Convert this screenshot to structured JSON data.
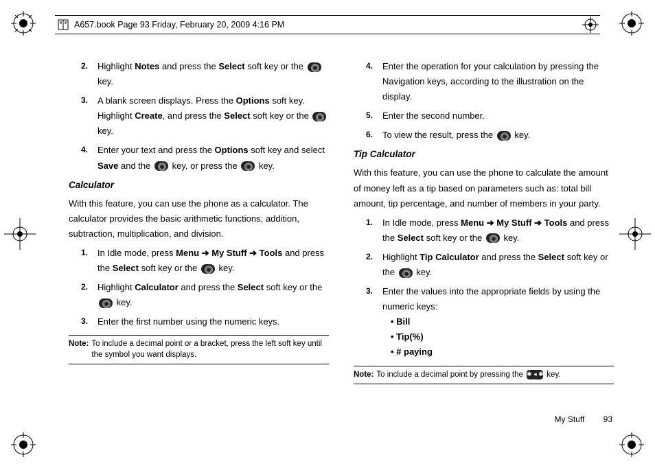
{
  "header": {
    "text": "A657.book  Page 93  Friday, February 20, 2009  4:16 PM"
  },
  "left": {
    "s2a": "Highlight ",
    "s2b": "Notes",
    "s2c": " and press the ",
    "s2d": "Select",
    "s2e": " soft key or the ",
    "s2f": " key.",
    "s3a": "A blank screen displays. Press the ",
    "s3b": "Options",
    "s3c": " soft key. Highlight ",
    "s3d": "Create",
    "s3e": ", and press the ",
    "s3f": "Select",
    "s3g": " soft key or the ",
    "s3h": " key.",
    "s4a": "Enter your text and press the ",
    "s4b": "Options",
    "s4c": " soft key and select ",
    "s4d": "Save",
    "s4e": " and the ",
    "s4f": " key, or press the ",
    "s4g": " key.",
    "calcHead": "Calculator",
    "calcPara": "With this feature, you can use the phone as a calculator. The calculator provides the basic arithmetic functions; addition, subtraction, multiplication, and division.",
    "c1a": "In Idle mode, press ",
    "c1b": "Menu",
    "c1c": "My Stuff",
    "c1d": "Tools",
    "c1e": " and press the ",
    "c1f": "Select",
    "c1g": " soft key or the ",
    "c1h": " key.",
    "c2a": "Highlight ",
    "c2b": "Calculator",
    "c2c": " and press the ",
    "c2d": "Select",
    "c2e": " soft key or the ",
    "c2f": " key.",
    "c3": "Enter the first number using the numeric keys.",
    "note1Label": "Note:",
    "note1": " To include a decimal point or a bracket, press the left soft key until the symbol you want displays."
  },
  "right": {
    "r4": "Enter the operation for your calculation by pressing the Navigation keys, according to the illustration on the display.",
    "r5": "Enter the second number.",
    "r6a": "To view the result, press the ",
    "r6b": " key.",
    "tipHead": "Tip Calculator",
    "tipPara": "With this feature, you can use the phone to calculate the amount of money left as a tip based on parameters such as: total bill amount, tip percentage, and number of members in your party.",
    "t1a": "In Idle mode, press ",
    "t1b": "Menu",
    "t1c": "My Stuff",
    "t1d": "Tools",
    "t1e": " and press the ",
    "t1f": "Select",
    "t1g": " soft key or the ",
    "t1h": " key.",
    "t2a": "Highlight ",
    "t2b": "Tip Calculator",
    "t2c": " and press the ",
    "t2d": "Select",
    "t2e": " soft key or the ",
    "t2f": " key.",
    "t3": "Enter the values into the appropriate fields by using the numeric keys:",
    "b1": "Bill",
    "b2": "Tip(%)",
    "b3": "# paying",
    "note2Label": "Note:",
    "note2a": " To include a decimal point by pressing the ",
    "note2b": " key."
  },
  "footer": {
    "section": "My Stuff",
    "page": "93"
  },
  "nums": {
    "n1": "1.",
    "n2": "2.",
    "n3": "3.",
    "n4": "4.",
    "n5": "5.",
    "n6": "6."
  },
  "arrow": " ➔ "
}
